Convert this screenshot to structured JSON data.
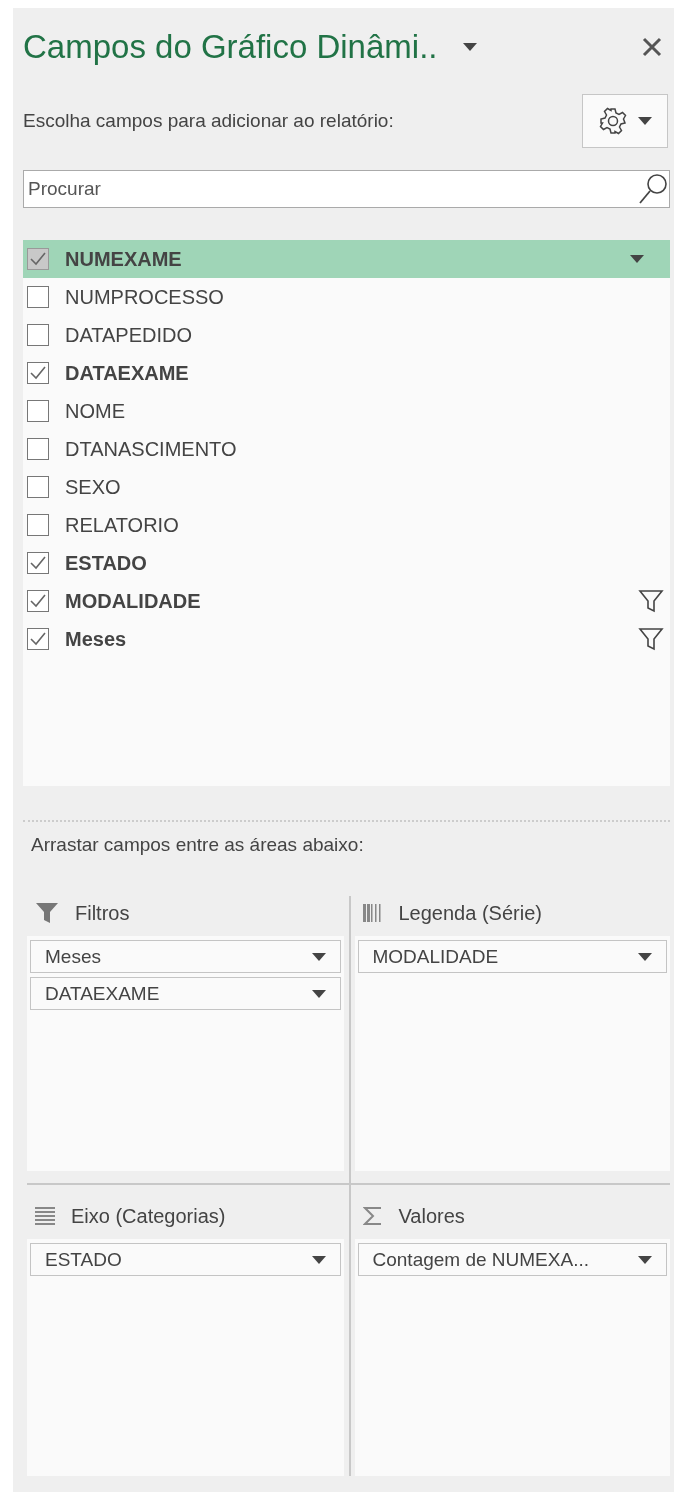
{
  "pane": {
    "title": "Campos do Gráfico Dinâmi..",
    "subtitle": "Escolha campos para adicionar ao relatório:"
  },
  "search": {
    "placeholder": "Procurar"
  },
  "fields": [
    {
      "label": "NUMEXAME",
      "checked": true,
      "selected": true,
      "filtered": false
    },
    {
      "label": "NUMPROCESSO",
      "checked": false,
      "selected": false,
      "filtered": false
    },
    {
      "label": "DATAPEDIDO",
      "checked": false,
      "selected": false,
      "filtered": false
    },
    {
      "label": "DATAEXAME",
      "checked": true,
      "selected": false,
      "filtered": false
    },
    {
      "label": "NOME",
      "checked": false,
      "selected": false,
      "filtered": false
    },
    {
      "label": "DTANASCIMENTO",
      "checked": false,
      "selected": false,
      "filtered": false
    },
    {
      "label": "SEXO",
      "checked": false,
      "selected": false,
      "filtered": false
    },
    {
      "label": "RELATORIO",
      "checked": false,
      "selected": false,
      "filtered": false
    },
    {
      "label": "ESTADO",
      "checked": true,
      "selected": false,
      "filtered": false
    },
    {
      "label": "MODALIDADE",
      "checked": true,
      "selected": false,
      "filtered": true
    },
    {
      "label": "Meses",
      "checked": true,
      "selected": false,
      "filtered": true
    }
  ],
  "areas_hint": "Arrastar campos entre as áreas abaixo:",
  "areas": [
    {
      "kind": "filters",
      "label": "Filtros",
      "items": [
        "Meses",
        "DATAEXAME"
      ]
    },
    {
      "kind": "legend",
      "label": "Legenda (Série)",
      "items": [
        "MODALIDADE"
      ]
    },
    {
      "kind": "axis",
      "label": "Eixo (Categorias)",
      "items": [
        "ESTADO"
      ]
    },
    {
      "kind": "values",
      "label": "Valores",
      "items": [
        "Contagem de NUMEXA..."
      ]
    }
  ]
}
